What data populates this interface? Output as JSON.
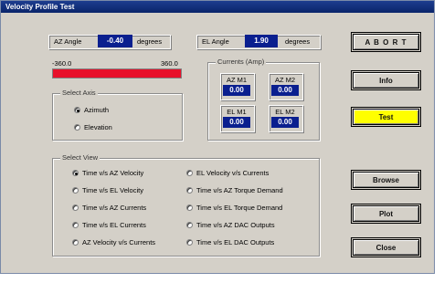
{
  "title": "Velocity Profile Test",
  "az": {
    "label": "AZ Angle",
    "value": "-0.40",
    "unit": "degrees"
  },
  "el": {
    "label": "EL Angle",
    "value": "1.90",
    "unit": "degrees"
  },
  "scale": {
    "min": "-360.0",
    "max": "360.0"
  },
  "bar_color": "#e8102a",
  "select_axis": {
    "title": "Select Axis",
    "options": [
      "Azimuth",
      "Elevation"
    ],
    "selected": 0
  },
  "currents": {
    "title": "Currents (Amp)",
    "az_m1": {
      "label": "AZ M1",
      "value": "0.00"
    },
    "az_m2": {
      "label": "AZ M2",
      "value": "0.00"
    },
    "el_m1": {
      "label": "EL M1",
      "value": "0.00"
    },
    "el_m2": {
      "label": "EL M2",
      "value": "0.00"
    }
  },
  "select_view": {
    "title": "Select View",
    "left": [
      "Time v/s AZ Velocity",
      "Time v/s EL Velocity",
      "Time v/s AZ Currents",
      "Time v/s EL Currents",
      "AZ Velocity v/s Currents"
    ],
    "right": [
      "EL Velocity v/s Currents",
      "Time v/s AZ Torque Demand",
      "Time v/s EL Torque Demand",
      "Time v/s AZ DAC Outputs",
      "Time v/s EL DAC Outputs"
    ],
    "selected": "Time v/s AZ Velocity"
  },
  "buttons": {
    "abort": "A B O R T",
    "info": "Info",
    "test": "Test",
    "browse": "Browse",
    "plot": "Plot",
    "close": "Close"
  },
  "test_color": "#ffff00"
}
